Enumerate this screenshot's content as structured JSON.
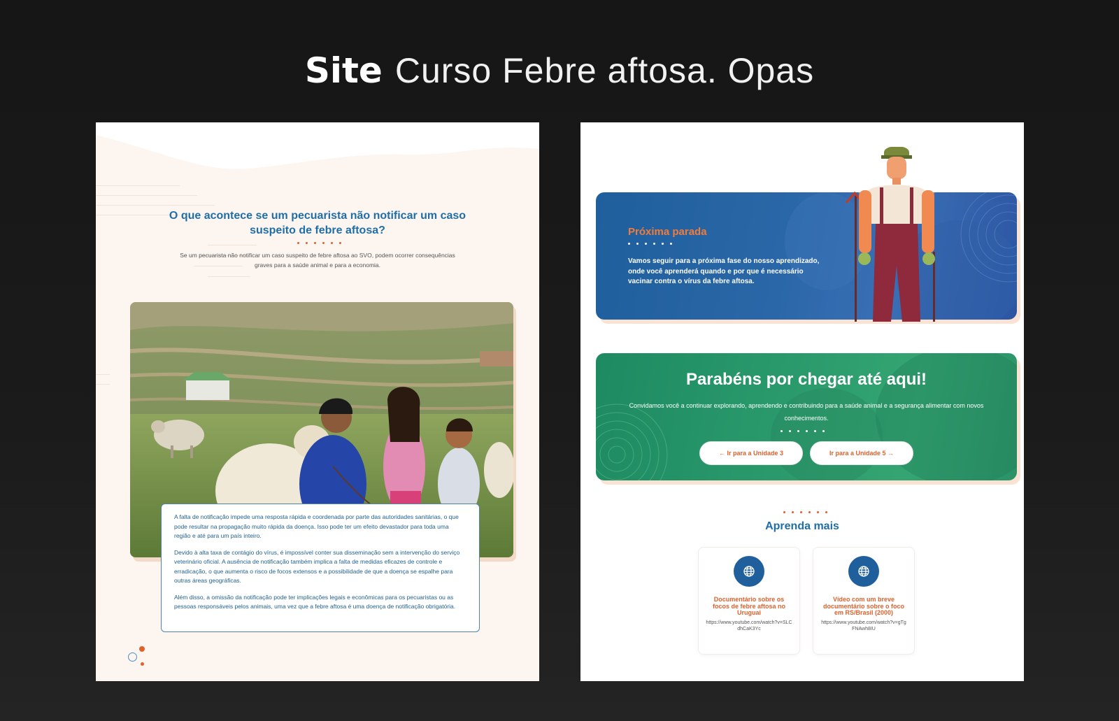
{
  "headline": {
    "bold": "Site",
    "light": "Curso Febre aftosa. Opas"
  },
  "left_page": {
    "title": "O que acontece se um pecuarista não notificar um caso suspeito de febre aftosa?",
    "subtitle": "Se um pecuarista não notificar um caso suspeito de febre aftosa ao SVO, podem ocorrer consequências graves para a saúde animal e para a economia.",
    "paragraphs": [
      "A falta de notificação impede uma resposta rápida e coordenada por parte das autoridades sanitárias, o que pode resultar na propagação muito rápida da doença. Isso pode ter um efeito devastador para toda uma região e até para um país inteiro.",
      "Devido à alta taxa de contágio do vírus, é impossível conter sua disseminação sem a intervenção do serviço veterinário oficial. A ausência de notificação também implica a falta de medidas eficazes de controle e erradicação, o que aumenta o risco de focos extensos e a possibilidade de que a doença se espalhe para outras áreas geográficas.",
      "Além disso, a omissão da notificação pode ter implicações legais e econômicas para os pecuaristas ou as pessoas responsáveis pelos animais, uma vez que a febre aftosa é uma doença de notificação obrigatória."
    ]
  },
  "right_page": {
    "next_stop": {
      "title": "Próxima parada",
      "text": "Vamos seguir para a próxima fase do nosso aprendizado, onde você aprenderá quando e por que é necessário vacinar contra o vírus da febre aftosa."
    },
    "congrats": {
      "title": "Parabéns por chegar até aqui!",
      "text": "Convidamos você a continuar explorando, aprendendo e contribuindo para a saúde animal e a segurança alimentar com novos conhecimentos.",
      "prev_button": "← Ir para a Unidade 3",
      "next_button": "Ir para a Unidade 5 →"
    },
    "learn_more": {
      "title": "Aprenda mais",
      "resources": [
        {
          "title": "Documentário sobre os focos de febre aftosa no Uruguai",
          "url": "https://www.youtube.com/watch?v=SLCdhCaK3Yc",
          "icon": "globe-icon"
        },
        {
          "title": "Vídeo com um breve documentário sobre o foco em RS/Brasil (2000)",
          "url": "https://www.youtube.com/watch?v=gTgFNAwh8IU",
          "icon": "globe-icon"
        }
      ]
    }
  },
  "colors": {
    "accent_orange": "#e0612c",
    "title_blue": "#1f6ea8",
    "card_blue": "#2a67a8",
    "card_green": "#2a9a6c",
    "page_cream": "#fdf5ef"
  }
}
